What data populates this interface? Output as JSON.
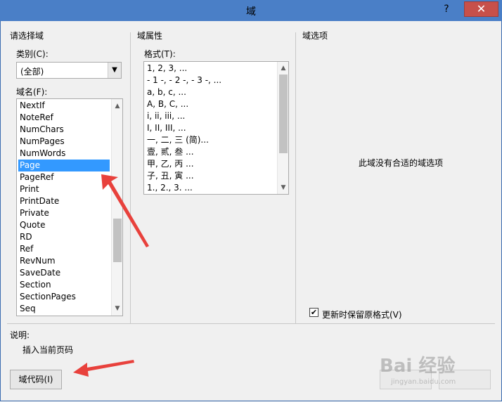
{
  "window": {
    "title": "域",
    "help": "?",
    "close": "✕"
  },
  "left": {
    "section_title": "请选择域",
    "category_label": "类别(C):",
    "category_value": "(全部)",
    "field_names_label": "域名(F):",
    "field_names": [
      "NextIf",
      "NoteRef",
      "NumChars",
      "NumPages",
      "NumWords",
      "Page",
      "PageRef",
      "Print",
      "PrintDate",
      "Private",
      "Quote",
      "RD",
      "Ref",
      "RevNum",
      "SaveDate",
      "Section",
      "SectionPages",
      "Seq"
    ],
    "selected_index": 5
  },
  "middle": {
    "section_title": "域属性",
    "format_label": "格式(T):",
    "formats": [
      "1, 2, 3, ...",
      "- 1 -, - 2 -, - 3 -, ...",
      "a, b, c, ...",
      "A, B, C, ...",
      "i, ii, iii, ...",
      "I, II, III, ...",
      "一, 二, 三 (简)...",
      "壹, 贰, 叁 ...",
      "甲, 乙, 丙 ...",
      "子, 丑, 寅 ...",
      "1., 2., 3. ..."
    ]
  },
  "right": {
    "section_title": "域选项",
    "empty_message": "此域没有合适的域选项",
    "preserve_checkbox_label": "更新时保留原格式(V)",
    "preserve_checked": true
  },
  "description": {
    "label": "说明:",
    "text": "插入当前页码"
  },
  "buttons": {
    "field_codes": "域代码(I)"
  },
  "watermark": {
    "main": "Bai 经验",
    "sub": "jingyan.baidu.com"
  },
  "colors": {
    "titlebar": "#4a7fc7",
    "close": "#c7504a",
    "selection": "#3399ff",
    "annotation_arrow": "#e8413c"
  }
}
